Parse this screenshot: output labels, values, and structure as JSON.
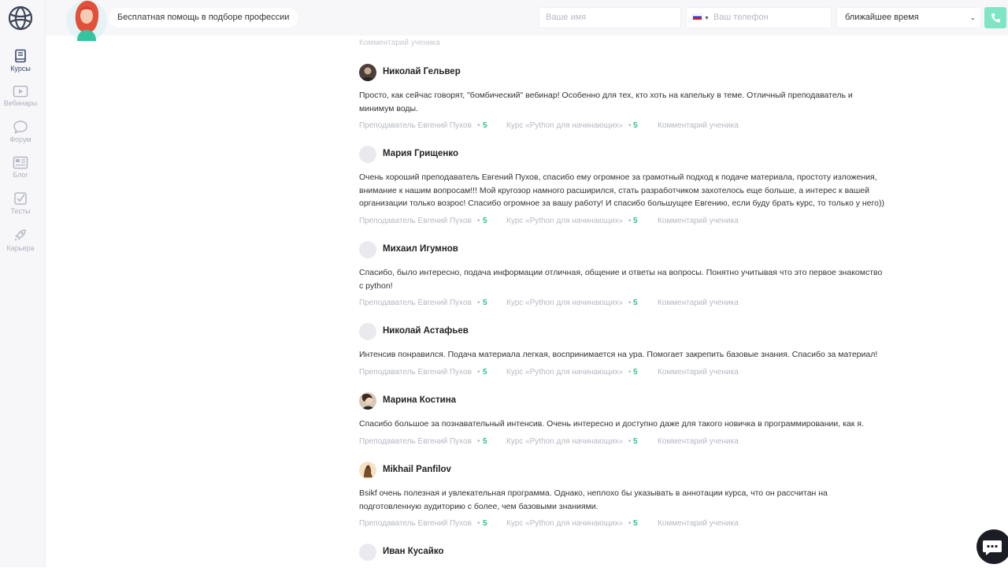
{
  "header": {
    "help_text": "Бесплатная помощь в подборе профессии",
    "name_placeholder": "Ваше имя",
    "phone_placeholder": "Ваш телефон",
    "time_select": "ближайшее время"
  },
  "sidebar": {
    "items": [
      {
        "label": "Курсы",
        "icon": "book-icon"
      },
      {
        "label": "Вебинары",
        "icon": "play-icon"
      },
      {
        "label": "Форум",
        "icon": "chat-icon"
      },
      {
        "label": "Блог",
        "icon": "news-icon"
      },
      {
        "label": "Тесты",
        "icon": "checkbox-icon"
      },
      {
        "label": "Карьера",
        "icon": "rocket-icon"
      }
    ]
  },
  "cut_label": "Комментарий ученика",
  "reviews": [
    {
      "name": "Николай Гельвер",
      "text": "Просто, как сейчас говорят, \"бомбический\" вебинар! Особенно для тех, кто хоть на капельку в теме. Отличный преподаватель и минимум воды.",
      "teacher": "Преподаватель Евгений Пухов",
      "teacher_score": "5",
      "course": "Курс «Python для начинающих»",
      "course_score": "5",
      "comment": "Комментарий ученика"
    },
    {
      "name": "Мария Грищенко",
      "text": "Очень хороший преподаватель Евгений Пухов, спасибо ему огромное за грамотный подход к подаче материала, простоту изложения, внимание к нашим вопросам!!! Мой кругозор намного расширился, стать разработчиком захотелось еще больше, а интерес к вашей организации только возрос! Спасибо огромное за вашу работу! И спасибо большущее Евгению, если буду брать курс, то только у него))",
      "teacher": "Преподаватель Евгений Пухов",
      "teacher_score": "5",
      "course": "Курс «Python для начинающих»",
      "course_score": "5",
      "comment": "Комментарий ученика"
    },
    {
      "name": "Михаил Игумнов",
      "text": "Спасибо, было интересно, подача информации отличная, общение и ответы на вопросы. Понятно учитывая что это первое знакомство с python!",
      "teacher": "Преподаватель Евгений Пухов",
      "teacher_score": "5",
      "course": "Курс «Python для начинающих»",
      "course_score": "5",
      "comment": "Комментарий ученика"
    },
    {
      "name": "Николай Астафьев",
      "text": "Интенсив понравился. Подача материала легкая, воспринимается на ура. Помогает закрепить базовые знания. Спасибо за материал!",
      "teacher": "Преподаватель Евгений Пухов",
      "teacher_score": "5",
      "course": "Курс «Python для начинающих»",
      "course_score": "5",
      "comment": "Комментарий ученика"
    },
    {
      "name": "Марина Костина",
      "text": "Спасибо большое за познавательный интенсив. Очень интересно и доступно даже для такого новичка в программировании, как я.",
      "teacher": "Преподаватель Евгений Пухов",
      "teacher_score": "5",
      "course": "Курс «Python для начинающих»",
      "course_score": "5",
      "comment": "Комментарий ученика"
    },
    {
      "name": "Mikhail Panfilov",
      "text": "Bsikf очень полезная и увлекательная программа. Однако, неплохо бы указывать в аннотации курса, что он рассчитан на подготовленную аудиторию с более, чем базовыми знаниями.",
      "teacher": "Преподаватель Евгений Пухов",
      "teacher_score": "5",
      "course": "Курс «Python для начинающих»",
      "course_score": "5",
      "comment": "Комментарий ученика"
    },
    {
      "name": "Иван Кусайко"
    }
  ],
  "colors": {
    "accent_green": "#28c28a",
    "call_button": "#7ee6c4",
    "sidebar_bg": "#f7f7fa"
  }
}
